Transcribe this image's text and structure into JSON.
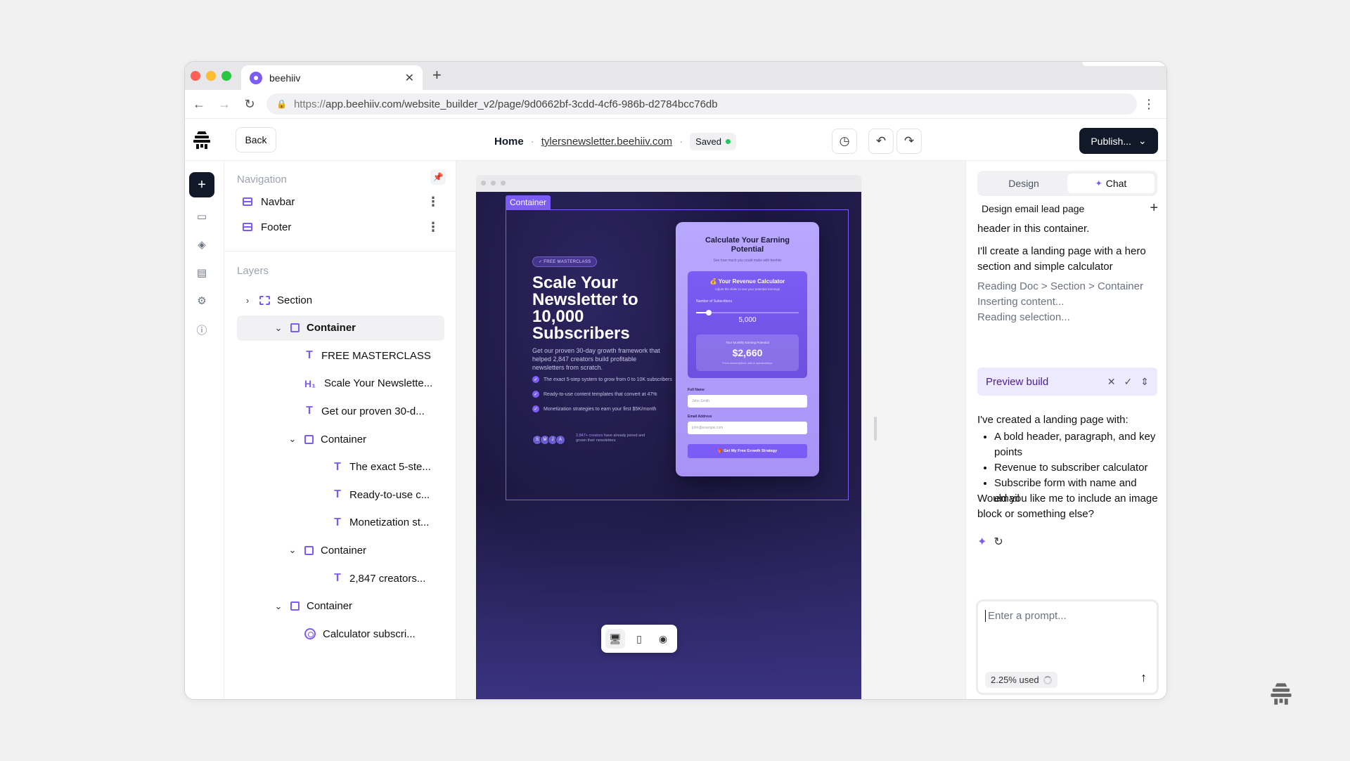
{
  "browser": {
    "tab_title": "beehiiv",
    "url_protocol": "https://",
    "url_rest": "app.beehiiv.com/website_builder_v2/page/9d0662bf-3cdd-4cf6-986b-d2784bcc76db"
  },
  "header": {
    "back_label": "Back",
    "breadcrumb_home": "Home",
    "breadcrumb_domain": "tylersnewsletter.beehiiv.com",
    "saved_label": "Saved",
    "publish_label": "Publish..."
  },
  "left_panel": {
    "navigation_title": "Navigation",
    "nav_items": [
      "Navbar",
      "Footer"
    ],
    "layers_title": "Layers",
    "layers": [
      {
        "label": "Section",
        "icon": "section",
        "indent": 0,
        "chevron": "right"
      },
      {
        "label": "Container",
        "icon": "box",
        "indent": 1,
        "chevron": "down",
        "selected": true
      },
      {
        "label": "FREE MASTERCLASS",
        "icon": "text",
        "indent": 2
      },
      {
        "label": "Scale Your Newslette...",
        "icon": "heading",
        "indent": 2
      },
      {
        "label": "Get our proven 30-d...",
        "icon": "text",
        "indent": 2
      },
      {
        "label": "Container",
        "icon": "box",
        "indent": 2,
        "chevron": "down"
      },
      {
        "label": "The exact 5-ste...",
        "icon": "text",
        "indent": 3
      },
      {
        "label": "Ready-to-use c...",
        "icon": "text",
        "indent": 3
      },
      {
        "label": "Monetization st...",
        "icon": "text",
        "indent": 3
      },
      {
        "label": "Container",
        "icon": "box",
        "indent": 2,
        "chevron": "down"
      },
      {
        "label": "2,847 creators...",
        "icon": "text",
        "indent": 3
      },
      {
        "label": "Container",
        "icon": "box",
        "indent": 1,
        "chevron": "down"
      },
      {
        "label": "Calculator subscri...",
        "icon": "component",
        "indent": 2
      }
    ]
  },
  "canvas": {
    "selection_tag": "Container",
    "badge": "✓ FREE MASTERCLASS",
    "hero_title": "Scale Your Newsletter to 10,000 Subscribers",
    "hero_paragraph": "Get our proven 30-day growth framework that helped 2,847 creators build profitable newsletters from scratch.",
    "points": [
      "The exact 5-step system to grow from 0 to 10K subscribers",
      "Ready-to-use content templates that convert at 47%",
      "Monetization strategies to earn your first $5K/month"
    ],
    "avatars": [
      "S",
      "M",
      "J",
      "A"
    ],
    "social_highlight": "2,847+ creators",
    "social_rest": " have already joined and grown their newsletters",
    "card": {
      "title": "Calculate Your Earning Potential",
      "subtitle": "See how much you could make with beehiiv",
      "calc_title": "💰 Your Revenue Calculator",
      "calc_subtitle": "Adjust the slider to see your potential earnings",
      "subscribers_label": "Number of Subscribers",
      "slider_fraction": 0.12,
      "subscribers_value": "5,000",
      "earning_label": "Your Monthly Earning Potential",
      "earning_value": "$2,660",
      "earning_sub": "From subscriptions, ads & sponsorships",
      "name_label": "Full Name",
      "name_placeholder": "John Smith",
      "email_label": "Email Address",
      "email_placeholder": "john@example.com",
      "cta_label": "🎁 Get My Free Growth Strategy"
    }
  },
  "right_panel": {
    "tab_design": "Design",
    "tab_chat": "Chat",
    "chat_title": "Design email lead page",
    "msg_partial": "header in this container.",
    "msg_intro": "I'll create a landing page with a hero section and simple calculator",
    "status_lines": [
      "Reading Doc > Section > Container",
      "Inserting content...",
      "Reading selection..."
    ],
    "preview_build_label": "Preview build",
    "result_intro": "I've created a landing page with:",
    "result_bullets": [
      "A bold header, paragraph, and key points",
      "Revenue to subscriber calculator",
      "Subscribe form with name and email"
    ],
    "followup": "Would you like me to include an image block or something else?",
    "prompt_placeholder": "Enter a prompt...",
    "usage_label": "2.25% used"
  },
  "colors": {
    "accent": "#7c5cf4",
    "dark": "#111827",
    "saved_dot": "#22c55e"
  }
}
